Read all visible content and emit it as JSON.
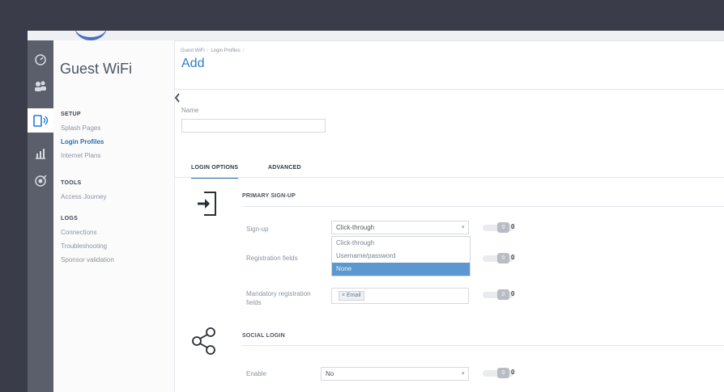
{
  "app": {
    "title": "Guest WiFi"
  },
  "rail": {
    "icons": [
      "dashboard-icon",
      "users-icon",
      "guest-wifi-icon",
      "reports-icon",
      "target-icon"
    ]
  },
  "sidebar": {
    "setup_heading": "SETUP",
    "setup_items": [
      {
        "label": "Splash Pages"
      },
      {
        "label": "Login Profiles"
      },
      {
        "label": "Internet Plans"
      }
    ],
    "tools_heading": "TOOLS",
    "tools_items": [
      {
        "label": "Access Journey"
      }
    ],
    "logs_heading": "LOGS",
    "logs_items": [
      {
        "label": "Connections"
      },
      {
        "label": "Troubleshooting"
      },
      {
        "label": "Sponsor validation"
      }
    ]
  },
  "breadcrumb": {
    "items": [
      "Guest WiFi",
      "Login Profiles"
    ]
  },
  "page": {
    "title": "Add"
  },
  "form": {
    "name_label": "Name",
    "name_value": ""
  },
  "tabs": [
    {
      "label": "LOGIN OPTIONS",
      "active": true
    },
    {
      "label": "ADVANCED",
      "active": false
    }
  ],
  "primary": {
    "title": "PRIMARY SIGN-UP",
    "signup_label": "Sign-up",
    "signup_value": "Click-through",
    "regfields_label": "Registration fields",
    "mandatory_label": "Mandatory registration fields",
    "mandatory_tag": "Email",
    "dropdown_options": [
      "Click-through",
      "Username/password",
      "None"
    ],
    "dropdown_highlighted": "None"
  },
  "social": {
    "title": "SOCIAL LOGIN",
    "enable_label": "Enable",
    "enable_value": "No"
  },
  "toggle": {
    "knob_text": "0",
    "info_text": "0"
  },
  "colors": {
    "accent": "#2a6fb0",
    "highlight": "#5c97cf",
    "rail": "#5b5f6b",
    "backdrop": "#3a3c49"
  }
}
